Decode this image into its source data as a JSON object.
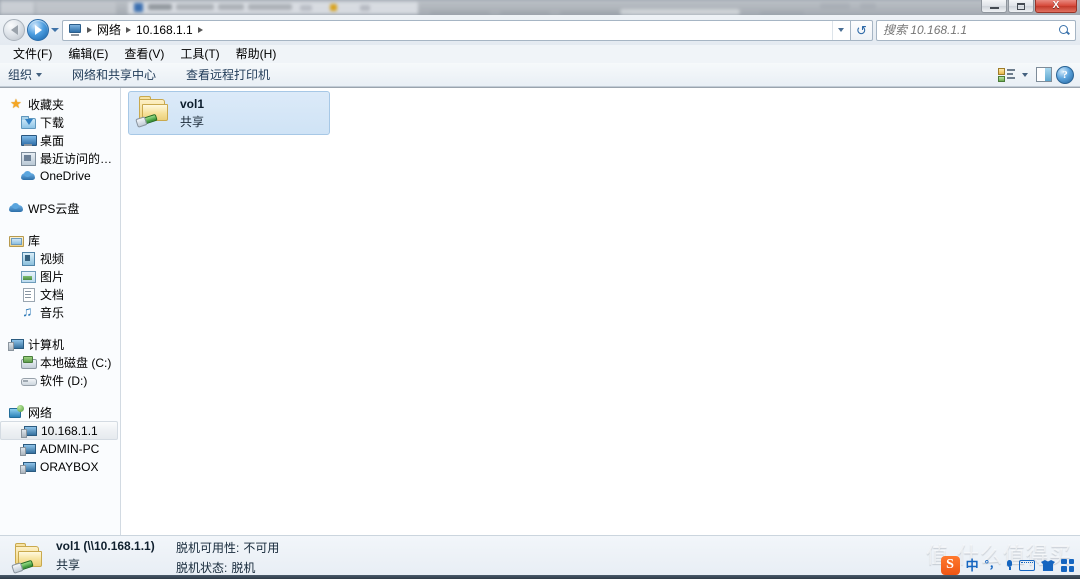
{
  "window": {
    "controls": {
      "minimize": "–",
      "maximize": "□",
      "close": "X"
    }
  },
  "navbar": {
    "back_tooltip": "后退",
    "forward_tooltip": "前进",
    "breadcrumbs": [
      "网络",
      "10.168.1.1"
    ],
    "refresh_icon": "↺",
    "address_dropdown_icon": "chevron-down-icon"
  },
  "search": {
    "placeholder": "搜索 10.168.1.1",
    "value": "",
    "icon": "search-icon"
  },
  "menubar": {
    "items": [
      {
        "label": "文件(F)"
      },
      {
        "label": "编辑(E)"
      },
      {
        "label": "查看(V)"
      },
      {
        "label": "工具(T)"
      },
      {
        "label": "帮助(H)"
      }
    ]
  },
  "commandbar": {
    "organize": "组织",
    "network_sharing_center": "网络和共享中心",
    "view_remote_printers": "查看远程打印机",
    "help_glyph": "?",
    "icons": [
      "view-mode-icon",
      "chevron-down-icon",
      "preview-pane-icon",
      "help-icon"
    ]
  },
  "sidebar": {
    "groups": [
      {
        "header": {
          "label": "收藏夹",
          "icon": "star-icon"
        },
        "items": [
          {
            "label": "下载",
            "icon": "downloads-folder-icon"
          },
          {
            "label": "桌面",
            "icon": "desktop-icon"
          },
          {
            "label": "最近访问的位置",
            "icon": "recent-places-icon"
          },
          {
            "label": "OneDrive",
            "icon": "cloud-icon"
          }
        ]
      },
      {
        "header": {
          "label": "WPS云盘",
          "icon": "cloud-icon"
        },
        "items": []
      },
      {
        "header": {
          "label": "库",
          "icon": "library-icon"
        },
        "items": [
          {
            "label": "视频",
            "icon": "video-icon"
          },
          {
            "label": "图片",
            "icon": "pictures-icon"
          },
          {
            "label": "文档",
            "icon": "documents-icon"
          },
          {
            "label": "音乐",
            "icon": "music-icon"
          }
        ]
      },
      {
        "header": {
          "label": "计算机",
          "icon": "computer-icon"
        },
        "items": [
          {
            "label": "本地磁盘 (C:)",
            "icon": "harddisk-icon"
          },
          {
            "label": "软件 (D:)",
            "icon": "drive-icon"
          }
        ]
      },
      {
        "header": {
          "label": "网络",
          "icon": "network-icon"
        },
        "items": [
          {
            "label": "10.168.1.1",
            "icon": "computer-icon",
            "selected": true
          },
          {
            "label": "ADMIN-PC",
            "icon": "computer-icon"
          },
          {
            "label": "ORAYBOX",
            "icon": "computer-icon"
          }
        ]
      }
    ]
  },
  "content": {
    "items": [
      {
        "name": "vol1",
        "subtitle": "共享",
        "icon": "shared-folder-icon",
        "selected": true
      }
    ]
  },
  "statusbar": {
    "icon": "shared-folder-icon",
    "title": "vol1 (\\\\10.168.1.1)",
    "subtitle": "共享",
    "offline_availability_label": "脱机可用性:",
    "offline_availability_value": "不可用",
    "offline_status_label": "脱机状态:",
    "offline_status_value": "脱机"
  },
  "watermark": {
    "text": "值 什么值得买"
  },
  "ime": {
    "logo": "S",
    "mode": "中",
    "degree": "°，",
    "icons": [
      "sogou-logo-icon",
      "chinese-mode-icon",
      "punctuation-icon",
      "voice-input-icon",
      "soft-keyboard-icon",
      "skin-icon",
      "toolbox-icon"
    ]
  },
  "colors": {
    "accent": "#2f6aa8",
    "selection": "#cfe3f6",
    "close_button": "#d6493a",
    "ime_blue": "#1565c0",
    "ime_orange": "#ef5514"
  }
}
